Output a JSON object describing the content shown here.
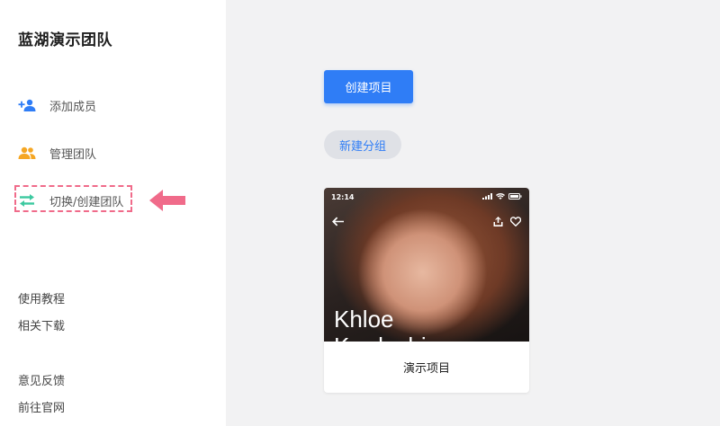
{
  "sidebar": {
    "team_name": "蓝湖演示团队",
    "nav": [
      {
        "label": "添加成员",
        "icon": "add-user-icon",
        "color": "#2f7df6"
      },
      {
        "label": "管理团队",
        "icon": "team-icon",
        "color": "#f5a623"
      },
      {
        "label": "切换/创建团队",
        "icon": "switch-icon",
        "color": "#3cc9a0",
        "highlighted": true
      }
    ],
    "footer_links": [
      "使用教程",
      "相关下载",
      "意见反馈",
      "前往官网"
    ]
  },
  "main": {
    "create_project_label": "创建项目",
    "new_group_label": "新建分组",
    "project_card": {
      "title": "演示项目",
      "thumbnail": {
        "status_time": "12:14",
        "name_line1": "Khloe",
        "name_line2": "Kardashian"
      }
    }
  },
  "colors": {
    "accent": "#2f7df6",
    "highlight_annotation": "#f06b8a",
    "background": "#f2f2f3"
  }
}
